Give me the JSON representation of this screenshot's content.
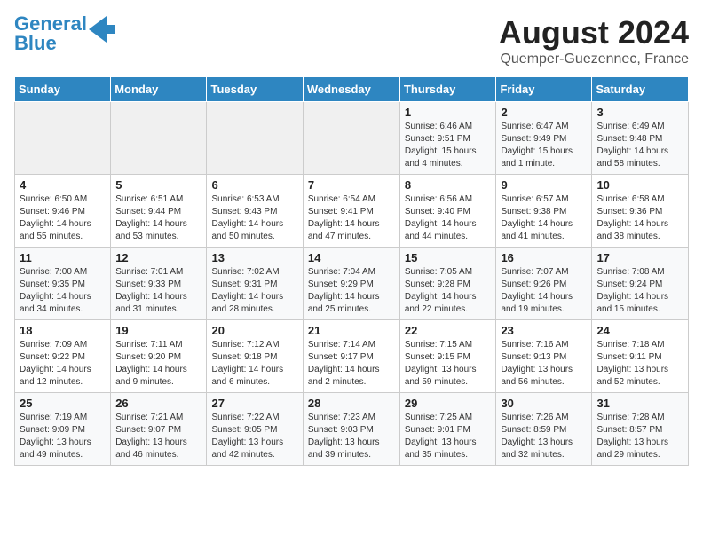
{
  "header": {
    "logo_line1": "General",
    "logo_line2": "Blue",
    "title": "August 2024",
    "subtitle": "Quemper-Guezennec, France"
  },
  "days_of_week": [
    "Sunday",
    "Monday",
    "Tuesday",
    "Wednesday",
    "Thursday",
    "Friday",
    "Saturday"
  ],
  "weeks": [
    [
      {
        "day": "",
        "info": ""
      },
      {
        "day": "",
        "info": ""
      },
      {
        "day": "",
        "info": ""
      },
      {
        "day": "",
        "info": ""
      },
      {
        "day": "1",
        "info": "Sunrise: 6:46 AM\nSunset: 9:51 PM\nDaylight: 15 hours\nand 4 minutes."
      },
      {
        "day": "2",
        "info": "Sunrise: 6:47 AM\nSunset: 9:49 PM\nDaylight: 15 hours\nand 1 minute."
      },
      {
        "day": "3",
        "info": "Sunrise: 6:49 AM\nSunset: 9:48 PM\nDaylight: 14 hours\nand 58 minutes."
      }
    ],
    [
      {
        "day": "4",
        "info": "Sunrise: 6:50 AM\nSunset: 9:46 PM\nDaylight: 14 hours\nand 55 minutes."
      },
      {
        "day": "5",
        "info": "Sunrise: 6:51 AM\nSunset: 9:44 PM\nDaylight: 14 hours\nand 53 minutes."
      },
      {
        "day": "6",
        "info": "Sunrise: 6:53 AM\nSunset: 9:43 PM\nDaylight: 14 hours\nand 50 minutes."
      },
      {
        "day": "7",
        "info": "Sunrise: 6:54 AM\nSunset: 9:41 PM\nDaylight: 14 hours\nand 47 minutes."
      },
      {
        "day": "8",
        "info": "Sunrise: 6:56 AM\nSunset: 9:40 PM\nDaylight: 14 hours\nand 44 minutes."
      },
      {
        "day": "9",
        "info": "Sunrise: 6:57 AM\nSunset: 9:38 PM\nDaylight: 14 hours\nand 41 minutes."
      },
      {
        "day": "10",
        "info": "Sunrise: 6:58 AM\nSunset: 9:36 PM\nDaylight: 14 hours\nand 38 minutes."
      }
    ],
    [
      {
        "day": "11",
        "info": "Sunrise: 7:00 AM\nSunset: 9:35 PM\nDaylight: 14 hours\nand 34 minutes."
      },
      {
        "day": "12",
        "info": "Sunrise: 7:01 AM\nSunset: 9:33 PM\nDaylight: 14 hours\nand 31 minutes."
      },
      {
        "day": "13",
        "info": "Sunrise: 7:02 AM\nSunset: 9:31 PM\nDaylight: 14 hours\nand 28 minutes."
      },
      {
        "day": "14",
        "info": "Sunrise: 7:04 AM\nSunset: 9:29 PM\nDaylight: 14 hours\nand 25 minutes."
      },
      {
        "day": "15",
        "info": "Sunrise: 7:05 AM\nSunset: 9:28 PM\nDaylight: 14 hours\nand 22 minutes."
      },
      {
        "day": "16",
        "info": "Sunrise: 7:07 AM\nSunset: 9:26 PM\nDaylight: 14 hours\nand 19 minutes."
      },
      {
        "day": "17",
        "info": "Sunrise: 7:08 AM\nSunset: 9:24 PM\nDaylight: 14 hours\nand 15 minutes."
      }
    ],
    [
      {
        "day": "18",
        "info": "Sunrise: 7:09 AM\nSunset: 9:22 PM\nDaylight: 14 hours\nand 12 minutes."
      },
      {
        "day": "19",
        "info": "Sunrise: 7:11 AM\nSunset: 9:20 PM\nDaylight: 14 hours\nand 9 minutes."
      },
      {
        "day": "20",
        "info": "Sunrise: 7:12 AM\nSunset: 9:18 PM\nDaylight: 14 hours\nand 6 minutes."
      },
      {
        "day": "21",
        "info": "Sunrise: 7:14 AM\nSunset: 9:17 PM\nDaylight: 14 hours\nand 2 minutes."
      },
      {
        "day": "22",
        "info": "Sunrise: 7:15 AM\nSunset: 9:15 PM\nDaylight: 13 hours\nand 59 minutes."
      },
      {
        "day": "23",
        "info": "Sunrise: 7:16 AM\nSunset: 9:13 PM\nDaylight: 13 hours\nand 56 minutes."
      },
      {
        "day": "24",
        "info": "Sunrise: 7:18 AM\nSunset: 9:11 PM\nDaylight: 13 hours\nand 52 minutes."
      }
    ],
    [
      {
        "day": "25",
        "info": "Sunrise: 7:19 AM\nSunset: 9:09 PM\nDaylight: 13 hours\nand 49 minutes."
      },
      {
        "day": "26",
        "info": "Sunrise: 7:21 AM\nSunset: 9:07 PM\nDaylight: 13 hours\nand 46 minutes."
      },
      {
        "day": "27",
        "info": "Sunrise: 7:22 AM\nSunset: 9:05 PM\nDaylight: 13 hours\nand 42 minutes."
      },
      {
        "day": "28",
        "info": "Sunrise: 7:23 AM\nSunset: 9:03 PM\nDaylight: 13 hours\nand 39 minutes."
      },
      {
        "day": "29",
        "info": "Sunrise: 7:25 AM\nSunset: 9:01 PM\nDaylight: 13 hours\nand 35 minutes."
      },
      {
        "day": "30",
        "info": "Sunrise: 7:26 AM\nSunset: 8:59 PM\nDaylight: 13 hours\nand 32 minutes."
      },
      {
        "day": "31",
        "info": "Sunrise: 7:28 AM\nSunset: 8:57 PM\nDaylight: 13 hours\nand 29 minutes."
      }
    ]
  ]
}
